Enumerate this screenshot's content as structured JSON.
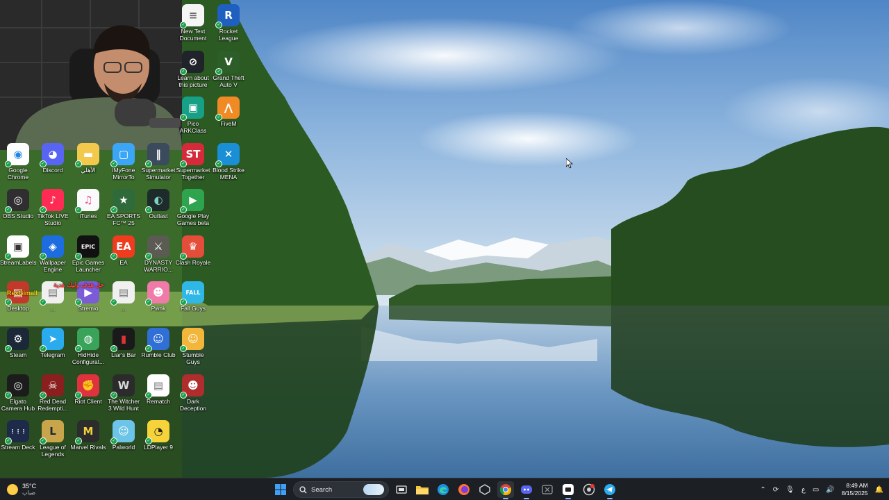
{
  "desktop_icons": [
    {
      "label": "New Text Document",
      "color": "#f5f5f5",
      "glyph": "≡",
      "glyph_color": "#6b6b6b"
    },
    {
      "label": "Rocket League",
      "color": "#1f5fbf",
      "glyph": "R",
      "glyph_color": "#ffffff"
    },
    {
      "label": "Learn about this picture",
      "color": "#20242a",
      "glyph": "⊘",
      "glyph_color": "#ffffff"
    },
    {
      "label": "Grand Theft Auto V",
      "color": "#2d5e2a",
      "glyph": "V",
      "glyph_color": "#ffffff"
    },
    {
      "label": "Pico ARKClass",
      "color": "#16a085",
      "glyph": "▣",
      "glyph_color": "#ffffff"
    },
    {
      "label": "FiveM",
      "color": "#f08a24",
      "glyph": "⋀",
      "glyph_color": "#ffffff"
    },
    {
      "label": "Google Chrome",
      "color": "#ffffff",
      "glyph": "◉",
      "glyph_color": "#1e88e5"
    },
    {
      "label": "Discord",
      "color": "#5865f2",
      "glyph": "◕",
      "glyph_color": "#ffffff"
    },
    {
      "label": "الأهلي",
      "color": "#f2c94c",
      "glyph": "▬",
      "glyph_color": "#ffffff"
    },
    {
      "label": "iMyFone MirrorTo",
      "color": "#3aa6f5",
      "glyph": "▢",
      "glyph_color": "#ffffff"
    },
    {
      "label": "Supermarket Simulator",
      "color": "#3b4a5c",
      "glyph": "‖",
      "glyph_color": "#ffffff"
    },
    {
      "label": "Supermarket Together",
      "color": "#d42a3a",
      "glyph": "ST",
      "glyph_color": "#ffffff"
    },
    {
      "label": "Blood Strike MENA",
      "color": "#1a8fd6",
      "glyph": "✕",
      "glyph_color": "#ffffff"
    },
    {
      "label": "OBS Studio",
      "color": "#302e31",
      "glyph": "◎",
      "glyph_color": "#ffffff"
    },
    {
      "label": "TikTok LIVE Studio",
      "color": "#fe2c55",
      "glyph": "♪",
      "glyph_color": "#ffffff"
    },
    {
      "label": "iTunes",
      "color": "#fafafa",
      "glyph": "♫",
      "glyph_color": "#e94b8d"
    },
    {
      "label": "EA SPORTS FC™ 25",
      "color": "#2f6b3a",
      "glyph": "★",
      "glyph_color": "#ffffff"
    },
    {
      "label": "Outlast",
      "color": "#1d2c2a",
      "glyph": "◐",
      "glyph_color": "#7fd1c2"
    },
    {
      "label": "Google Play Games beta",
      "color": "#2ea44f",
      "glyph": "▶",
      "glyph_color": "#ffffff"
    },
    {
      "label": "StreamLabels",
      "color": "#ffffff",
      "glyph": "▣",
      "glyph_color": "#333333"
    },
    {
      "label": "Wallpaper Engine",
      "color": "#1d6ce0",
      "glyph": "◈",
      "glyph_color": "#ffffff"
    },
    {
      "label": "Epic Games Launcher",
      "color": "#111111",
      "glyph": "EPIC",
      "glyph_color": "#ffffff"
    },
    {
      "label": "EA",
      "color": "#ef3b1e",
      "glyph": "EA",
      "glyph_color": "#ffffff"
    },
    {
      "label": "DYNASTY WARRIO...",
      "color": "#5b5a53",
      "glyph": "⚔",
      "glyph_color": "#ffffff"
    },
    {
      "label": "Clash Royale",
      "color": "#e54d3b",
      "glyph": "♛",
      "glyph_color": "#ffffff"
    },
    {
      "label": "Desktop",
      "color": "#c0392b",
      "glyph": "▤",
      "glyph_color": "#ffffff"
    },
    {
      "label": "...",
      "color": "#f0f0f0",
      "glyph": "▤",
      "glyph_color": "#777777"
    },
    {
      "label": "Stremio",
      "color": "#7b5bd6",
      "glyph": "▶",
      "glyph_color": "#ffffff"
    },
    {
      "label": "...",
      "color": "#f0f0f0",
      "glyph": "▤",
      "glyph_color": "#777777"
    },
    {
      "label": "Pwnk",
      "color": "#f07aa8",
      "glyph": "☻",
      "glyph_color": "#ffffff"
    },
    {
      "label": "Fall Guys",
      "color": "#2fb7e6",
      "glyph": "FALL",
      "glyph_color": "#ffffff"
    },
    {
      "label": "Steam",
      "color": "#1b2838",
      "glyph": "⚙",
      "glyph_color": "#ffffff"
    },
    {
      "label": "Telegram",
      "color": "#2aabee",
      "glyph": "➤",
      "glyph_color": "#ffffff"
    },
    {
      "label": "HidHide Configurat...",
      "color": "#3aa35a",
      "glyph": "◍",
      "glyph_color": "#ffffff"
    },
    {
      "label": "Liar's Bar",
      "color": "#1a1a1a",
      "glyph": "▮",
      "glyph_color": "#d33"
    },
    {
      "label": "Rumble Club",
      "color": "#2f6fd6",
      "glyph": "☺",
      "glyph_color": "#ffffff"
    },
    {
      "label": "Stumble Guys",
      "color": "#f2b63a",
      "glyph": "☺",
      "glyph_color": "#ffffff"
    },
    {
      "label": "Elgato Camera Hub",
      "color": "#1c1c1c",
      "glyph": "◎",
      "glyph_color": "#ffffff"
    },
    {
      "label": "Red Dead Redempti...",
      "color": "#8a1f1f",
      "glyph": "☠",
      "glyph_color": "#ffffff"
    },
    {
      "label": "Riot Client",
      "color": "#e0313e",
      "glyph": "✊",
      "glyph_color": "#ffffff"
    },
    {
      "label": "The Witcher 3 Wild Hunt",
      "color": "#2b2b2b",
      "glyph": "W",
      "glyph_color": "#d8d8d8"
    },
    {
      "label": "Rematch",
      "color": "#ffffff",
      "glyph": "▤",
      "glyph_color": "#777777"
    },
    {
      "label": "Dark Deception",
      "color": "#b02d2d",
      "glyph": "☻",
      "glyph_color": "#ffffff"
    },
    {
      "label": "Stream Deck",
      "color": "#1e2a4a",
      "glyph": "⋮⋮⋮",
      "glyph_color": "#ffffff"
    },
    {
      "label": "League of Legends",
      "color": "#c8a44a",
      "glyph": "L",
      "glyph_color": "#1b2838"
    },
    {
      "label": "Marvel Rivals",
      "color": "#2c2c2c",
      "glyph": "M",
      "glyph_color": "#f4d03f"
    },
    {
      "label": "Palworld",
      "color": "#6cc4e8",
      "glyph": "☺",
      "glyph_color": "#ffffff"
    },
    {
      "label": "LDPlayer 9",
      "color": "#f6d23b",
      "glyph": "◔",
      "glyph_color": "#222222"
    }
  ],
  "overlay_text": [
    "حل هدف وليك هدية",
    "RexGimall"
  ],
  "taskbar": {
    "weather": {
      "temp": "35°C",
      "desc": "ضباب"
    },
    "search_placeholder": "Search",
    "apps": [
      "start-icon",
      "search",
      "task-view-icon",
      "file-explorer-icon",
      "edge-icon",
      "firefox-icon",
      "unity-icon",
      "chrome-icon",
      "discord-icon",
      "xbox-icon",
      "streamlabs-icon",
      "chrome-alt-icon",
      "telegram-icon"
    ],
    "tray_lang": "ع",
    "time": "8:49 AM",
    "date": "8/15/2025"
  },
  "colors": {
    "taskbar_bg": "#1c1f24",
    "accent": "#3b82f6",
    "label_text": "#ffffff"
  }
}
